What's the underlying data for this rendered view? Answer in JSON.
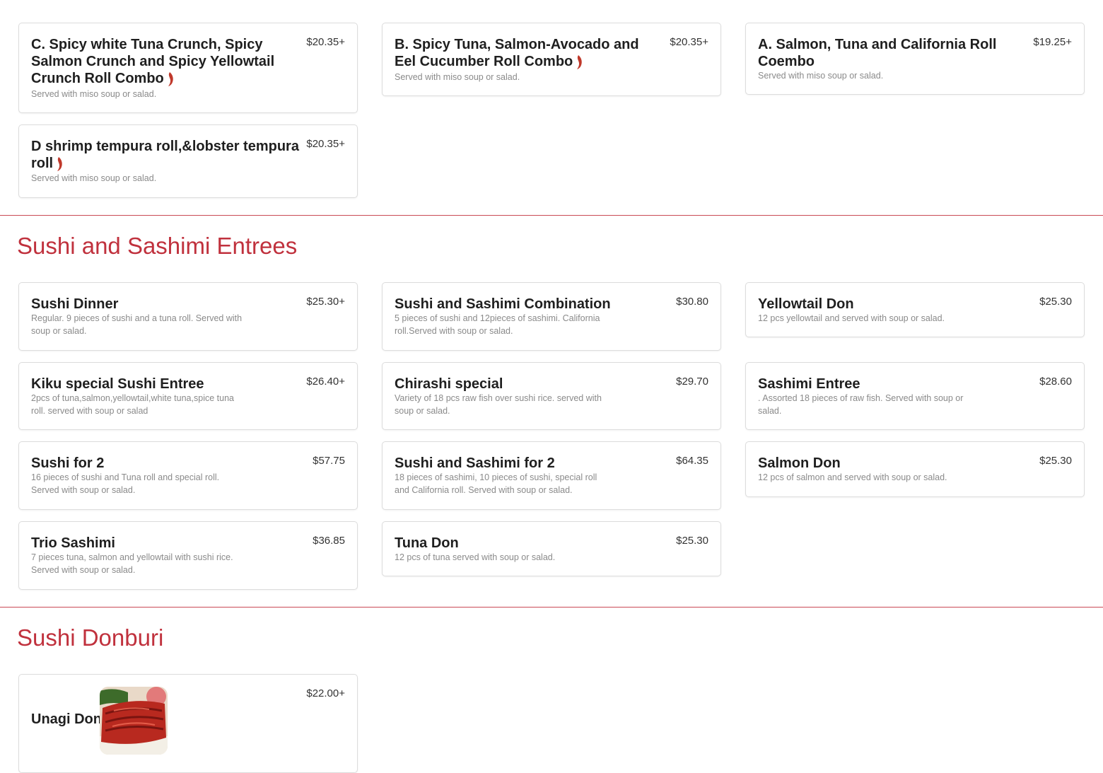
{
  "combos": {
    "items": [
      {
        "name": "C. Spicy white Tuna Crunch, Spicy Salmon Crunch and Spicy Yellowtail Crunch Roll Combo",
        "price": "$20.35+",
        "desc": "Served with miso soup or salad.",
        "spicy": true
      },
      {
        "name": "B. Spicy Tuna, Salmon-Avocado and Eel Cucumber Roll Combo",
        "price": "$20.35+",
        "desc": "Served with miso soup or salad.",
        "spicy": true
      },
      {
        "name": "A. Salmon, Tuna and California Roll Coembo",
        "price": "$19.25+",
        "desc": "Served with miso soup or salad.",
        "spicy": false
      },
      {
        "name": "D shrimp tempura roll,&lobster tempura roll",
        "price": "$20.35+",
        "desc": "Served with miso soup or salad.",
        "spicy": true
      }
    ]
  },
  "sushi_sashimi": {
    "title": "Sushi and Sashimi Entrees",
    "items": [
      {
        "name": "Sushi Dinner",
        "price": "$25.30+",
        "desc": "Regular. 9 pieces of sushi and a tuna roll. Served with soup or salad."
      },
      {
        "name": "Sushi and Sashimi Combination",
        "price": "$30.80",
        "desc": "5 pieces of sushi and 12pieces of sashimi. California roll.Served with soup or salad."
      },
      {
        "name": "Yellowtail Don",
        "price": "$25.30",
        "desc": "12 pcs yellowtail and served with soup or salad."
      },
      {
        "name": "Kiku special Sushi Entree",
        "price": "$26.40+",
        "desc": "2pcs of tuna,salmon,yellowtail,white tuna,spice tuna roll. served with soup or salad"
      },
      {
        "name": "Chirashi special",
        "price": "$29.70",
        "desc": "Variety of 18 pcs raw fish over sushi rice. served with soup or salad."
      },
      {
        "name": "Sashimi Entree",
        "price": "$28.60",
        "desc": ". Assorted 18 pieces of raw fish. Served with soup or salad."
      },
      {
        "name": "Sushi for 2",
        "price": "$57.75",
        "desc": "16 pieces of sushi and Tuna roll and special roll. Served with soup or salad."
      },
      {
        "name": "Sushi and Sashimi for 2",
        "price": "$64.35",
        "desc": "18 pieces of sashimi, 10 pieces of sushi, special roll and California roll. Served with soup or salad."
      },
      {
        "name": "Salmon Don",
        "price": "$25.30",
        "desc": "12 pcs of salmon and served with soup or salad."
      },
      {
        "name": "Trio Sashimi",
        "price": "$36.85",
        "desc": "7 pieces tuna, salmon and yellowtail with sushi rice. Served with soup or salad."
      },
      {
        "name": "Tuna Don",
        "price": "$25.30",
        "desc": "12 pcs of tuna served with soup or salad."
      }
    ]
  },
  "donburi": {
    "title": "Sushi Donburi",
    "items": [
      {
        "name": "Unagi Don",
        "price": "$22.00+"
      }
    ]
  },
  "colors": {
    "accent": "#c0313d",
    "divider": "#c94a55",
    "pepper": "#c0392b"
  }
}
